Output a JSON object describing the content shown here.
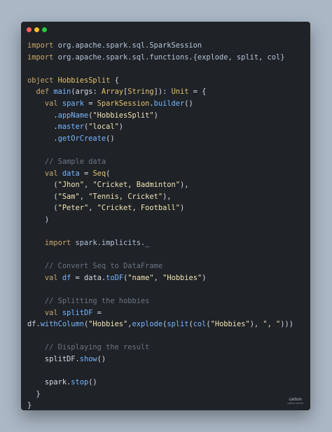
{
  "window": {
    "controls": [
      "close",
      "minimize",
      "maximize"
    ]
  },
  "code_lines": [
    [
      {
        "cls": "kw",
        "text": "import"
      },
      {
        "cls": "",
        "text": " "
      },
      {
        "cls": "pkg",
        "text": "org.apache.spark.sql.SparkSession"
      }
    ],
    [
      {
        "cls": "kw",
        "text": "import"
      },
      {
        "cls": "",
        "text": " "
      },
      {
        "cls": "pkg",
        "text": "org.apache.spark.sql.functions.{explode, split, col}"
      }
    ],
    [],
    [
      {
        "cls": "kw",
        "text": "object"
      },
      {
        "cls": "",
        "text": " "
      },
      {
        "cls": "ty",
        "text": "HobbiesSplit"
      },
      {
        "cls": "",
        "text": " {"
      }
    ],
    [
      {
        "cls": "",
        "text": "  "
      },
      {
        "cls": "kw",
        "text": "def"
      },
      {
        "cls": "",
        "text": " "
      },
      {
        "cls": "fn",
        "text": "main"
      },
      {
        "cls": "",
        "text": "(args: "
      },
      {
        "cls": "ty",
        "text": "Array"
      },
      {
        "cls": "",
        "text": "["
      },
      {
        "cls": "ty",
        "text": "String"
      },
      {
        "cls": "",
        "text": "]): "
      },
      {
        "cls": "ty",
        "text": "Unit"
      },
      {
        "cls": "",
        "text": " = {"
      }
    ],
    [
      {
        "cls": "",
        "text": "    "
      },
      {
        "cls": "kw",
        "text": "val"
      },
      {
        "cls": "",
        "text": " "
      },
      {
        "cls": "fn",
        "text": "spark"
      },
      {
        "cls": "",
        "text": " = "
      },
      {
        "cls": "ty",
        "text": "SparkSession"
      },
      {
        "cls": "",
        "text": "."
      },
      {
        "cls": "fn",
        "text": "builder"
      },
      {
        "cls": "",
        "text": "()"
      }
    ],
    [
      {
        "cls": "",
        "text": "      ."
      },
      {
        "cls": "fn",
        "text": "appName"
      },
      {
        "cls": "",
        "text": "("
      },
      {
        "cls": "str",
        "text": "\"HobbiesSplit\""
      },
      {
        "cls": "",
        "text": ")"
      }
    ],
    [
      {
        "cls": "",
        "text": "      ."
      },
      {
        "cls": "fn",
        "text": "master"
      },
      {
        "cls": "",
        "text": "("
      },
      {
        "cls": "str",
        "text": "\"local\""
      },
      {
        "cls": "",
        "text": ")"
      }
    ],
    [
      {
        "cls": "",
        "text": "      ."
      },
      {
        "cls": "fn",
        "text": "getOrCreate"
      },
      {
        "cls": "",
        "text": "()"
      }
    ],
    [],
    [
      {
        "cls": "",
        "text": "    "
      },
      {
        "cls": "cm",
        "text": "// Sample data"
      }
    ],
    [
      {
        "cls": "",
        "text": "    "
      },
      {
        "cls": "kw",
        "text": "val"
      },
      {
        "cls": "",
        "text": " "
      },
      {
        "cls": "fn",
        "text": "data"
      },
      {
        "cls": "",
        "text": " = "
      },
      {
        "cls": "ty",
        "text": "Seq"
      },
      {
        "cls": "",
        "text": "("
      }
    ],
    [
      {
        "cls": "",
        "text": "      ("
      },
      {
        "cls": "str",
        "text": "\"Jhon\""
      },
      {
        "cls": "",
        "text": ", "
      },
      {
        "cls": "str",
        "text": "\"Cricket, Badminton\""
      },
      {
        "cls": "",
        "text": "),"
      }
    ],
    [
      {
        "cls": "",
        "text": "      ("
      },
      {
        "cls": "str",
        "text": "\"Sam\""
      },
      {
        "cls": "",
        "text": ", "
      },
      {
        "cls": "str",
        "text": "\"Tennis, Cricket\""
      },
      {
        "cls": "",
        "text": "),"
      }
    ],
    [
      {
        "cls": "",
        "text": "      ("
      },
      {
        "cls": "str",
        "text": "\"Peter\""
      },
      {
        "cls": "",
        "text": ", "
      },
      {
        "cls": "str",
        "text": "\"Cricket, Football\""
      },
      {
        "cls": "",
        "text": ")"
      }
    ],
    [
      {
        "cls": "",
        "text": "    )"
      }
    ],
    [],
    [
      {
        "cls": "",
        "text": "    "
      },
      {
        "cls": "kw",
        "text": "import"
      },
      {
        "cls": "",
        "text": " "
      },
      {
        "cls": "pkg",
        "text": "spark.implicits._"
      }
    ],
    [],
    [
      {
        "cls": "",
        "text": "    "
      },
      {
        "cls": "cm",
        "text": "// Convert Seq to DataFrame"
      }
    ],
    [
      {
        "cls": "",
        "text": "    "
      },
      {
        "cls": "kw",
        "text": "val"
      },
      {
        "cls": "",
        "text": " "
      },
      {
        "cls": "fn",
        "text": "df"
      },
      {
        "cls": "",
        "text": " = data."
      },
      {
        "cls": "fn",
        "text": "toDF"
      },
      {
        "cls": "",
        "text": "("
      },
      {
        "cls": "str",
        "text": "\"name\""
      },
      {
        "cls": "",
        "text": ", "
      },
      {
        "cls": "str",
        "text": "\"Hobbies\""
      },
      {
        "cls": "",
        "text": ")"
      }
    ],
    [],
    [
      {
        "cls": "",
        "text": "    "
      },
      {
        "cls": "cm",
        "text": "// Splitting the hobbies"
      }
    ],
    [
      {
        "cls": "",
        "text": "    "
      },
      {
        "cls": "kw",
        "text": "val"
      },
      {
        "cls": "",
        "text": " "
      },
      {
        "cls": "fn",
        "text": "splitDF"
      },
      {
        "cls": "",
        "text": " ="
      }
    ],
    [
      {
        "cls": "",
        "text": "df."
      },
      {
        "cls": "fn",
        "text": "withColumn"
      },
      {
        "cls": "",
        "text": "("
      },
      {
        "cls": "str",
        "text": "\"Hobbies\""
      },
      {
        "cls": "",
        "text": ","
      },
      {
        "cls": "fn",
        "text": "explode"
      },
      {
        "cls": "",
        "text": "("
      },
      {
        "cls": "fn",
        "text": "split"
      },
      {
        "cls": "",
        "text": "("
      },
      {
        "cls": "fn",
        "text": "col"
      },
      {
        "cls": "",
        "text": "("
      },
      {
        "cls": "str",
        "text": "\"Hobbies\""
      },
      {
        "cls": "",
        "text": "), "
      },
      {
        "cls": "str",
        "text": "\", \""
      },
      {
        "cls": "",
        "text": ")))"
      }
    ],
    [],
    [
      {
        "cls": "",
        "text": "    "
      },
      {
        "cls": "cm",
        "text": "// Displaying the result"
      }
    ],
    [
      {
        "cls": "",
        "text": "    splitDF."
      },
      {
        "cls": "fn",
        "text": "show"
      },
      {
        "cls": "",
        "text": "()"
      }
    ],
    [],
    [
      {
        "cls": "",
        "text": "    spark."
      },
      {
        "cls": "fn",
        "text": "stop"
      },
      {
        "cls": "",
        "text": "()"
      }
    ],
    [
      {
        "cls": "",
        "text": "  }"
      }
    ],
    [
      {
        "cls": "",
        "text": "}"
      }
    ]
  ],
  "watermark": {
    "title": "carbon",
    "subtitle": "carbon.now.sh"
  }
}
